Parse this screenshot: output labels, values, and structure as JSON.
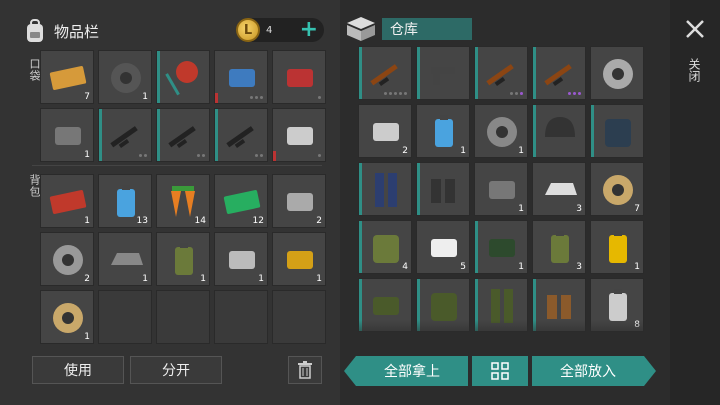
{
  "inventory": {
    "title": "物品栏",
    "pocket_label": "口袋",
    "backpack_label": "背包",
    "coin_count": "4",
    "coin_symbol": "L",
    "plus": "+",
    "pocket_slots": [
      {
        "icon": "coupon-ticket-icon",
        "qty": "7",
        "color": "#d69a3a"
      },
      {
        "icon": "duct-tape-icon",
        "qty": "1",
        "color": "#555"
      },
      {
        "icon": "stop-sign-icon",
        "qty": "",
        "color": "#c0392b",
        "mark": "teal"
      },
      {
        "icon": "spiked-mace-icon",
        "qty": "",
        "color": "#3e7bbf",
        "mark": "red",
        "dots": 3
      },
      {
        "icon": "crowbar-icon",
        "qty": "",
        "color": "#b33",
        "dots": 1
      },
      {
        "icon": "flashlight-icon",
        "qty": "1",
        "color": "#777"
      },
      {
        "icon": "assault-rifle-icon",
        "qty": "",
        "color": "#222",
        "mark": "teal",
        "dots": 2
      },
      {
        "icon": "assault-rifle-icon",
        "qty": "",
        "color": "#222",
        "mark": "teal",
        "dots": 2
      },
      {
        "icon": "assault-rifle-icon",
        "qty": "",
        "color": "#222",
        "mark": "teal",
        "dots": 2
      },
      {
        "icon": "machete-icon",
        "qty": "",
        "color": "#ccc",
        "mark": "red",
        "dots": 1
      }
    ],
    "backpack_slots": [
      {
        "icon": "coupon-red-icon",
        "qty": "1",
        "color": "#c0392b"
      },
      {
        "icon": "water-bottle-icon",
        "qty": "13",
        "color": "#4aa3df"
      },
      {
        "icon": "carrot-icon",
        "qty": "14",
        "color": "#e67e22"
      },
      {
        "icon": "coupon-green-icon",
        "qty": "12",
        "color": "#27ae60"
      },
      {
        "icon": "bolt-nut-icon",
        "qty": "2",
        "color": "#aaa"
      },
      {
        "icon": "bearing-icon",
        "qty": "2",
        "color": "#999"
      },
      {
        "icon": "metal-ingot-icon",
        "qty": "1",
        "color": "#888"
      },
      {
        "icon": "jerrycan-icon",
        "qty": "1",
        "color": "#6b7a3a"
      },
      {
        "icon": "wrench-icon",
        "qty": "1",
        "color": "#bbb"
      },
      {
        "icon": "gold-watch-icon",
        "qty": "1",
        "color": "#d4a017"
      },
      {
        "icon": "wire-spool-icon",
        "qty": "1",
        "color": "#c9a86a"
      },
      {
        "icon": "",
        "qty": "",
        "color": ""
      },
      {
        "icon": "",
        "qty": "",
        "color": ""
      },
      {
        "icon": "",
        "qty": "",
        "color": ""
      },
      {
        "icon": "",
        "qty": "",
        "color": ""
      }
    ],
    "use_label": "使用",
    "split_label": "分开"
  },
  "storage": {
    "title": "仓库",
    "slots": [
      {
        "icon": "ak-rifle-icon",
        "qty": "",
        "color": "#8b4513",
        "mark": "teal",
        "dots": 5
      },
      {
        "icon": "pistol-icon",
        "qty": "",
        "color": "#444",
        "mark": "teal"
      },
      {
        "icon": "ak-rifle-icon",
        "qty": "",
        "color": "#8b4513",
        "mark": "teal",
        "dots": 3,
        "purple": 1
      },
      {
        "icon": "ak-rifle-icon",
        "qty": "",
        "color": "#8b4513",
        "mark": "teal",
        "dots": 3,
        "purple": 3
      },
      {
        "icon": "wheel-icon",
        "qty": "",
        "color": "#aaa"
      },
      {
        "icon": "engine-part-icon",
        "qty": "2",
        "color": "#ccc"
      },
      {
        "icon": "fuel-can-icon",
        "qty": "1",
        "color": "#4aa3df"
      },
      {
        "icon": "gear-icon",
        "qty": "1",
        "color": "#888"
      },
      {
        "icon": "helmet-icon",
        "qty": "",
        "color": "#333",
        "mark": "teal"
      },
      {
        "icon": "body-armor-icon",
        "qty": "",
        "color": "#2c3e50",
        "mark": "teal"
      },
      {
        "icon": "pants-icon",
        "qty": "",
        "color": "#2c3e70",
        "mark": "teal"
      },
      {
        "icon": "boots-icon",
        "qty": "",
        "color": "#333",
        "mark": "teal"
      },
      {
        "icon": "spring-icon",
        "qty": "1",
        "color": "#777"
      },
      {
        "icon": "silver-ingots-icon",
        "qty": "3",
        "color": "#ddd"
      },
      {
        "icon": "wire-spool-icon",
        "qty": "7",
        "color": "#c9a86a"
      },
      {
        "icon": "military-backpack-icon",
        "qty": "4",
        "color": "#6b7a3a",
        "mark": "teal"
      },
      {
        "icon": "bandage-icon",
        "qty": "5",
        "color": "#eee"
      },
      {
        "icon": "gas-mask-icon",
        "qty": "1",
        "color": "#2d4a2d",
        "mark": "teal"
      },
      {
        "icon": "jerrycan-icon",
        "qty": "3",
        "color": "#6b7a3a"
      },
      {
        "icon": "oil-filter-icon",
        "qty": "1",
        "color": "#e6b800"
      },
      {
        "icon": "camo-cap-icon",
        "qty": "",
        "color": "#4a5a2a",
        "mark": "teal"
      },
      {
        "icon": "camo-jacket-icon",
        "qty": "",
        "color": "#4a5a2a",
        "mark": "teal"
      },
      {
        "icon": "camo-pants-icon",
        "qty": "",
        "color": "#4a5a2a",
        "mark": "teal"
      },
      {
        "icon": "leather-boots-icon",
        "qty": "",
        "color": "#8b5a2b",
        "mark": "teal"
      },
      {
        "icon": "spray-can-icon",
        "qty": "8",
        "color": "#ccc"
      }
    ],
    "take_all_label": "全部拿上",
    "put_all_label": "全部放入"
  },
  "close_label": "关闭"
}
